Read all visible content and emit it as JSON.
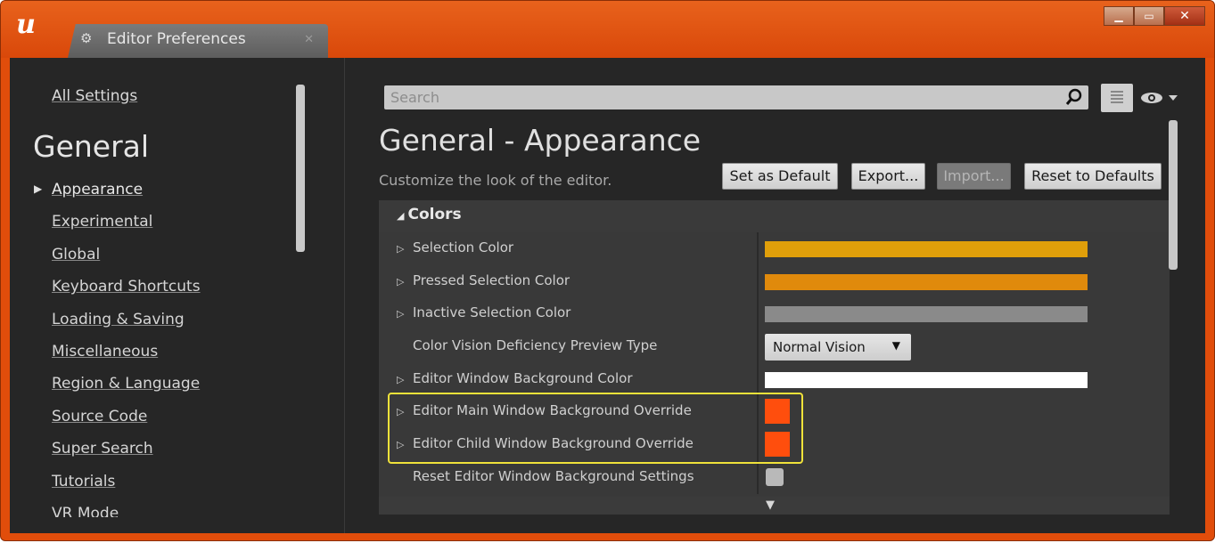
{
  "window": {
    "tab_title": "Editor Preferences",
    "controls": {
      "minimize": "▁",
      "maximize": "▭",
      "close": "✕"
    }
  },
  "sidebar": {
    "all_settings": "All Settings",
    "section_title": "General",
    "items": [
      {
        "label": "Appearance",
        "active": true
      },
      {
        "label": "Experimental"
      },
      {
        "label": "Global"
      },
      {
        "label": "Keyboard Shortcuts"
      },
      {
        "label": "Loading & Saving"
      },
      {
        "label": "Miscellaneous"
      },
      {
        "label": "Region & Language"
      },
      {
        "label": "Source Code"
      },
      {
        "label": "Super Search"
      },
      {
        "label": "Tutorials"
      },
      {
        "label": "VR Mode"
      }
    ]
  },
  "search": {
    "placeholder": "Search"
  },
  "main": {
    "title": "General - Appearance",
    "subtitle": "Customize the look of the editor.",
    "buttons": {
      "set_default": "Set as Default",
      "export": "Export...",
      "import": "Import...",
      "reset": "Reset to Defaults"
    },
    "category": "Colors",
    "rows": [
      {
        "label": "Selection Color",
        "expandable": true,
        "type": "color-bar",
        "color": "#e09f0a"
      },
      {
        "label": "Pressed Selection Color",
        "expandable": true,
        "type": "color-bar",
        "color": "#e08a0c"
      },
      {
        "label": "Inactive Selection Color",
        "expandable": true,
        "type": "color-bar",
        "color": "#8a8a8a"
      },
      {
        "label": "Color Vision Deficiency Preview Type",
        "expandable": false,
        "type": "dropdown",
        "value": "Normal Vision"
      },
      {
        "label": "Editor Window Background Color",
        "expandable": true,
        "type": "color-bar",
        "color": "#ffffff"
      },
      {
        "label": "Editor Main Window Background Override",
        "expandable": true,
        "type": "color-square",
        "color": "#ff4e0d"
      },
      {
        "label": "Editor Child Window Background Override",
        "expandable": true,
        "type": "color-square",
        "color": "#ff4e0d"
      },
      {
        "label": "Reset Editor Window Background Settings",
        "expandable": false,
        "type": "checkbox"
      }
    ]
  },
  "colors": {
    "window_frame": "#e14d0b",
    "background": "#262626",
    "highlight": "#f0e23a"
  }
}
